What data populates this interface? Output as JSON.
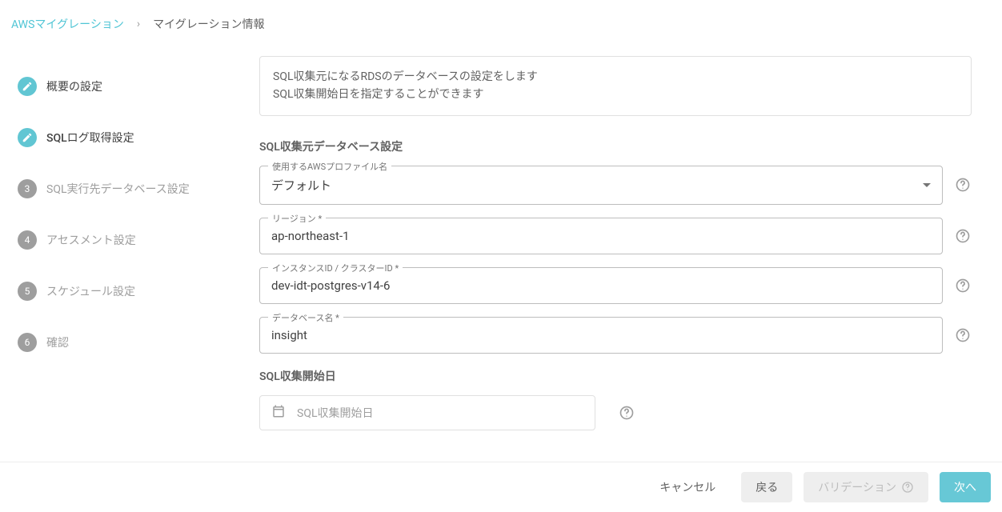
{
  "breadcrumb": {
    "root": "AWSマイグレーション",
    "current": "マイグレーション情報"
  },
  "steps": [
    {
      "label": "概要の設定",
      "state": "done"
    },
    {
      "label": "SQLログ取得設定",
      "state": "active"
    },
    {
      "label": "SQL実行先データベース設定",
      "state": "pending",
      "num": "3"
    },
    {
      "label": "アセスメント設定",
      "state": "pending",
      "num": "4"
    },
    {
      "label": "スケジュール設定",
      "state": "pending",
      "num": "5"
    },
    {
      "label": "確認",
      "state": "pending",
      "num": "6"
    }
  ],
  "intro": {
    "line1": "SQL収集元になるRDSのデータベースの設定をします",
    "line2": "SQL収集開始日を指定することができます"
  },
  "section_title": "SQL収集元データベース設定",
  "fields": {
    "profile": {
      "label": "使用するAWSプロファイル名",
      "value": "デフォルト"
    },
    "region": {
      "label": "リージョン *",
      "value": "ap-northeast-1"
    },
    "instance": {
      "label": "インスタンスID / クラスターID *",
      "value": "dev-idt-postgres-v14-6"
    },
    "database": {
      "label": "データベース名 *",
      "value": "insight"
    }
  },
  "date": {
    "section_label": "SQL収集開始日",
    "placeholder": "SQL収集開始日"
  },
  "footer": {
    "cancel": "キャンセル",
    "back": "戻る",
    "validate": "バリデーション",
    "next": "次へ"
  }
}
